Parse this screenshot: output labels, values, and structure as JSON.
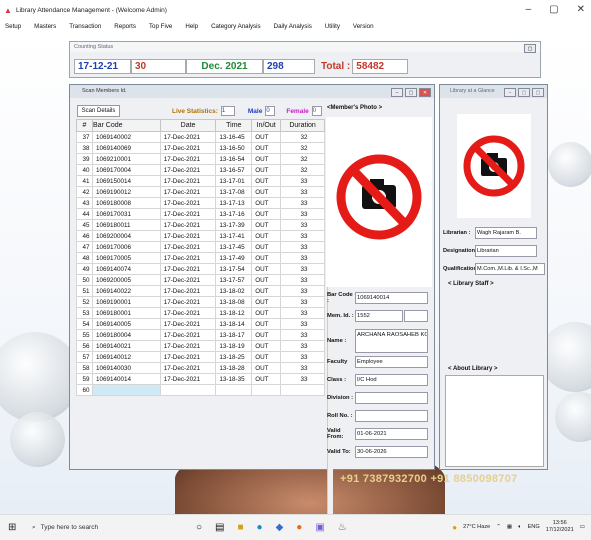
{
  "app": {
    "title": "Library Attendance Management - (Welcome Admin)"
  },
  "menu": [
    "Setup",
    "Masters",
    "Transaction",
    "Reports",
    "Top Five",
    "Help",
    "Category Analysis",
    "Daily Analysis",
    "Utility",
    "Version"
  ],
  "counting": {
    "title": "Counting Status",
    "date": "17-12-21",
    "count1": "30",
    "month": "Dec. 2021",
    "count2": "298",
    "total_label": "Total :",
    "total_value": "58482"
  },
  "scan": {
    "title": "Scan Members Id.",
    "tab": "Scan Details",
    "live_label": "Live Statistics:",
    "live_value": "1",
    "male_label": "Male",
    "male_value": "0",
    "female_label": "Female",
    "female_value": "0",
    "columns": [
      "#",
      "Bar Code",
      "Date",
      "Time",
      "In/Out",
      "Duration"
    ],
    "rows": [
      [
        "37",
        "1069140002",
        "17-Dec-2021",
        "13-16-45",
        "OUT",
        "32"
      ],
      [
        "38",
        "1069140069",
        "17-Dec-2021",
        "13-16-50",
        "OUT",
        "32"
      ],
      [
        "39",
        "1069210001",
        "17-Dec-2021",
        "13-16-54",
        "OUT",
        "32"
      ],
      [
        "40",
        "1069170004",
        "17-Dec-2021",
        "13-16-57",
        "OUT",
        "32"
      ],
      [
        "41",
        "1069150014",
        "17-Dec-2021",
        "13-17-01",
        "OUT",
        "33"
      ],
      [
        "42",
        "1069190012",
        "17-Dec-2021",
        "13-17-08",
        "OUT",
        "33"
      ],
      [
        "43",
        "1069180008",
        "17-Dec-2021",
        "13-17-13",
        "OUT",
        "33"
      ],
      [
        "44",
        "1069170031",
        "17-Dec-2021",
        "13-17-16",
        "OUT",
        "33"
      ],
      [
        "45",
        "1069180011",
        "17-Dec-2021",
        "13-17-39",
        "OUT",
        "33"
      ],
      [
        "46",
        "1069200004",
        "17-Dec-2021",
        "13-17-41",
        "OUT",
        "33"
      ],
      [
        "47",
        "1069170006",
        "17-Dec-2021",
        "13-17-45",
        "OUT",
        "33"
      ],
      [
        "48",
        "1069170005",
        "17-Dec-2021",
        "13-17-49",
        "OUT",
        "33"
      ],
      [
        "49",
        "1069140074",
        "17-Dec-2021",
        "13-17-54",
        "OUT",
        "33"
      ],
      [
        "50",
        "1069200005",
        "17-Dec-2021",
        "13-17-57",
        "OUT",
        "33"
      ],
      [
        "51",
        "1069140022",
        "17-Dec-2021",
        "13-18-02",
        "OUT",
        "33"
      ],
      [
        "52",
        "1069190001",
        "17-Dec-2021",
        "13-18-08",
        "OUT",
        "33"
      ],
      [
        "53",
        "1069180001",
        "17-Dec-2021",
        "13-18-12",
        "OUT",
        "33"
      ],
      [
        "54",
        "1069140005",
        "17-Dec-2021",
        "13-18-14",
        "OUT",
        "33"
      ],
      [
        "55",
        "1069180004",
        "17-Dec-2021",
        "13-18-17",
        "OUT",
        "33"
      ],
      [
        "56",
        "1069140021",
        "17-Dec-2021",
        "13-18-19",
        "OUT",
        "33"
      ],
      [
        "57",
        "1069140012",
        "17-Dec-2021",
        "13-18-25",
        "OUT",
        "33"
      ],
      [
        "58",
        "1069140030",
        "17-Dec-2021",
        "13-18-28",
        "OUT",
        "33"
      ],
      [
        "59",
        "1069140014",
        "17-Dec-2021",
        "13-18-35",
        "OUT",
        "33"
      ],
      [
        "60",
        "",
        "",
        "",
        "",
        ""
      ]
    ],
    "photo_label": "<Member's Photo >",
    "member": {
      "barcode_label": "Bar Code :",
      "barcode": "1069140014",
      "mem_id_label": "Mem. Id. :",
      "mem_id": "1552",
      "name_label": "Name :",
      "name": "ARCHANA RAOSAHEB KOTE",
      "faculty_label": "Faculty",
      "faculty": "Employee",
      "class_label": "Class :",
      "class": "I/C Hod",
      "division_label": "Division :",
      "division": "",
      "rollno_label": "Roll No. :",
      "rollno": "",
      "validfrom_label": "Valid From:",
      "validfrom": "01-06-2021",
      "validto_label": "Valid To:",
      "validto": "30-06-2026"
    }
  },
  "library": {
    "title": "Library at a Glance",
    "librarian_label": "Librarian :",
    "librarian": "Wagh Rajaram B.",
    "designation_label": "Designation:",
    "designation": "Librarian",
    "qualification_label": "Qualification:",
    "qualification": "M.Com.,M.Lib. & I.Sc.,M",
    "staff_group": "< Library Staff >",
    "about_group": "< About Library >"
  },
  "desktop": {
    "phone": "+91 7387932700 +91 8850098707"
  },
  "taskbar": {
    "search": "Type here to search",
    "weather": "27°C Haze",
    "lang": "ENG",
    "time": "13:56",
    "date": "17/12/2021"
  },
  "colors": {
    "accent": "#2f6fd6",
    "value_red": "#c0392b",
    "value_green": "#1e8a3a",
    "value_blue": "#1f3fb0",
    "prohibited": "#e41b17"
  }
}
